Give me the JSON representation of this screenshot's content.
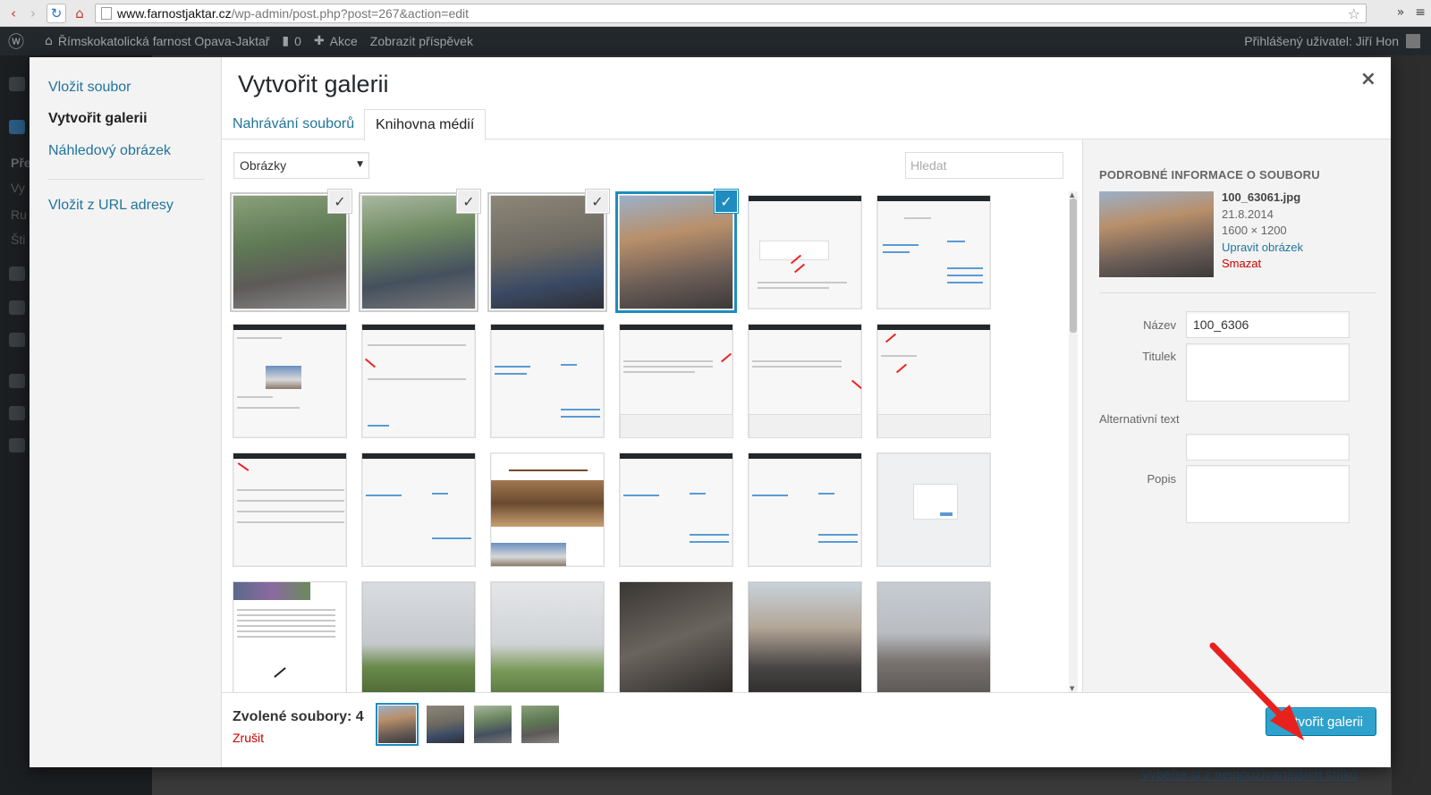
{
  "browser": {
    "url_host": "www.farnostjaktar.cz",
    "url_path": "/wp-admin/post.php?post=267&action=edit"
  },
  "adminbar": {
    "site_name": "Římskokatolická farnost Opava-Jaktař",
    "comments_count": "0",
    "new_label": "Akce",
    "view_post_label": "Zobrazit příspěvek",
    "user_label": "Přihlášený uživatel: Jiří Hon"
  },
  "background": {
    "side_texts": [
      "Pře",
      "Vy",
      "Ru",
      "Šti"
    ],
    "bottom_link": "Vyberte si z nejpoužívanějších štítků"
  },
  "media_menu": {
    "items": [
      {
        "label": "Vložit soubor",
        "active": false
      },
      {
        "label": "Vytvořit galerii",
        "active": true
      },
      {
        "label": "Náhledový obrázek",
        "active": false
      },
      {
        "label": "Vložit z URL adresy",
        "active": false
      }
    ]
  },
  "modal": {
    "title": "Vytvořit galerii",
    "close_symbol": "×",
    "tabs": [
      {
        "label": "Nahrávání souborů",
        "active": false
      },
      {
        "label": "Knihovna médií",
        "active": true
      }
    ],
    "filter_selected": "Obrázky",
    "search_placeholder": "Hledat"
  },
  "attachment_details": {
    "heading": "PODROBNÉ INFORMACE O SOUBORU",
    "filename": "100_63061.jpg",
    "date": "21.8.2014",
    "dimensions": "1600 × 1200",
    "edit_link": "Upravit obrázek",
    "delete_link": "Smazat",
    "fields": {
      "title_label": "Název",
      "title_value": "100_6306",
      "caption_label": "Titulek",
      "alt_label": "Alternativní text",
      "description_label": "Popis"
    }
  },
  "toolbar": {
    "selected_label": "Zvolené soubory: 4",
    "cancel_label": "Zrušit",
    "create_button": "Vytvořit galerii"
  },
  "colors": {
    "accent": "#1e8cbe",
    "link": "#21759b",
    "danger": "#cc0000",
    "primary_button": "#2ea2cc",
    "annotation": "#e8211d"
  }
}
